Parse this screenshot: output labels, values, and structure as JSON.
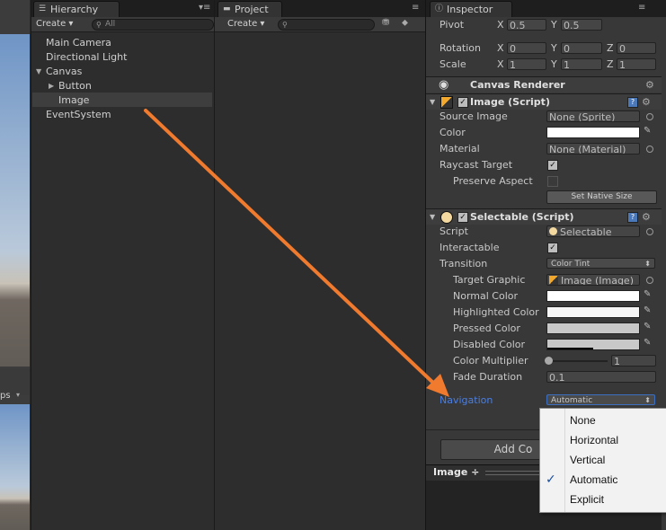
{
  "hierarchy": {
    "tab_label": "Hierarchy",
    "create_label": "Create ▾",
    "search_placeholder": "All",
    "items": [
      "Main Camera",
      "Directional Light",
      "Canvas",
      "Button",
      "Image",
      "EventSystem"
    ]
  },
  "project": {
    "tab_label": "Project",
    "create_label": "Create ▾"
  },
  "scene": {
    "toolbar_label": "ps"
  },
  "inspector": {
    "tab_label": "Inspector",
    "pivot": {
      "label": "Pivot",
      "x_label": "X",
      "x": "0.5",
      "y_label": "Y",
      "y": "0.5"
    },
    "rotation": {
      "label": "Rotation",
      "x_label": "X",
      "x": "0",
      "y_label": "Y",
      "y": "0",
      "z_label": "Z",
      "z": "0"
    },
    "scale": {
      "label": "Scale",
      "x_label": "X",
      "x": "1",
      "y_label": "Y",
      "y": "1",
      "z_label": "Z",
      "z": "1"
    },
    "canvas_renderer": {
      "title": "Canvas Renderer"
    },
    "image_script": {
      "title": "Image (Script)",
      "source_image_label": "Source Image",
      "source_image_value": "None (Sprite)",
      "color_label": "Color",
      "material_label": "Material",
      "material_value": "None (Material)",
      "raycast_label": "Raycast Target",
      "preserve_label": "Preserve Aspect",
      "set_native_size": "Set Native Size"
    },
    "selectable_script": {
      "title": "Selectable (Script)",
      "script_label": "Script",
      "script_value": "Selectable",
      "interactable_label": "Interactable",
      "transition_label": "Transition",
      "transition_value": "Color Tint",
      "target_graphic_label": "Target Graphic",
      "target_graphic_value": "Image (Image)",
      "normal_color_label": "Normal Color",
      "highlighted_color_label": "Highlighted Color",
      "pressed_color_label": "Pressed Color",
      "disabled_color_label": "Disabled Color",
      "color_multiplier_label": "Color Multiplier",
      "color_multiplier_value": "1",
      "fade_duration_label": "Fade Duration",
      "fade_duration_value": "0.1",
      "navigation_label": "Navigation",
      "navigation_value": "Automatic"
    },
    "add_component_label": "Add Co",
    "preview_label": "Image ÷"
  },
  "navigation_popup": {
    "options": [
      "None",
      "Horizontal",
      "Vertical",
      "Automatic",
      "Explicit"
    ],
    "selected": "Automatic"
  },
  "colors": {
    "arrow": "#f07a2e",
    "navigation_label": "#4b7ee0",
    "accent_blue": "#1a4fa0"
  }
}
